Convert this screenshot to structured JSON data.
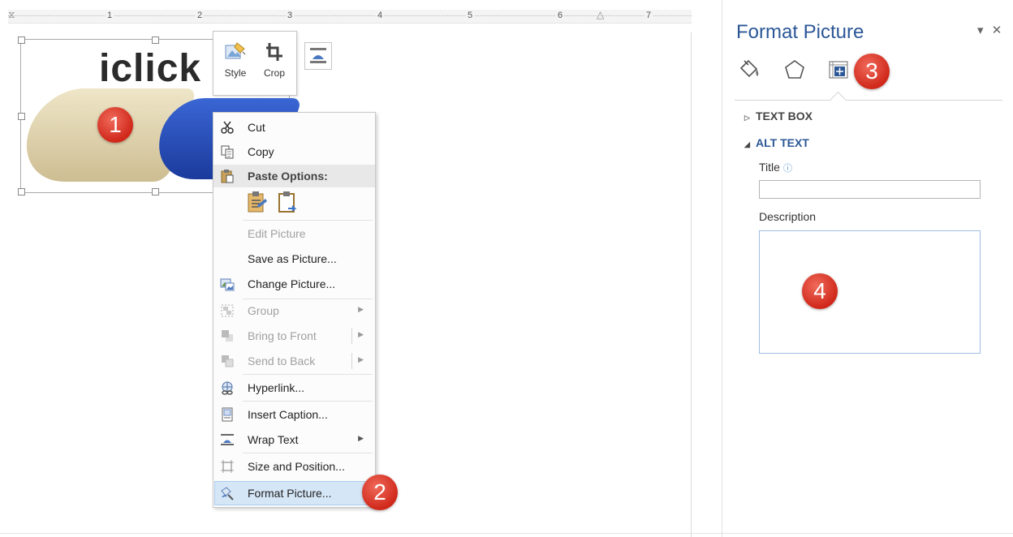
{
  "ruler": {
    "numbers": [
      "1",
      "2",
      "3",
      "4",
      "5",
      "6",
      "7"
    ]
  },
  "picture": {
    "logo_text": "iclick"
  },
  "mini_toolbar": {
    "style_label": "Style",
    "crop_label": "Crop"
  },
  "context_menu": {
    "items": [
      {
        "label": "Cut",
        "disabled": false
      },
      {
        "label": "Copy",
        "disabled": false
      },
      {
        "label": "Paste Options:",
        "disabled": false
      },
      {
        "label": "Edit Picture",
        "disabled": true
      },
      {
        "label": "Save as Picture...",
        "disabled": false
      },
      {
        "label": "Change Picture...",
        "disabled": false
      },
      {
        "label": "Group",
        "disabled": true
      },
      {
        "label": "Bring to Front",
        "disabled": true
      },
      {
        "label": "Send to Back",
        "disabled": true
      },
      {
        "label": "Hyperlink...",
        "disabled": false
      },
      {
        "label": "Insert Caption...",
        "disabled": false
      },
      {
        "label": "Wrap Text",
        "disabled": false
      },
      {
        "label": "Size and Position...",
        "disabled": false
      },
      {
        "label": "Format Picture...",
        "disabled": false
      }
    ]
  },
  "format_pane": {
    "title": "Format Picture",
    "sections": {
      "text_box": "TEXT BOX",
      "alt_text": "ALT TEXT"
    },
    "title_label": "Title",
    "description_label": "Description"
  },
  "badges": [
    "1",
    "2",
    "3",
    "4"
  ],
  "colors": {
    "accent": "#2b5797",
    "badge": "#d93a2b",
    "highlight": "#d5e6f7"
  }
}
